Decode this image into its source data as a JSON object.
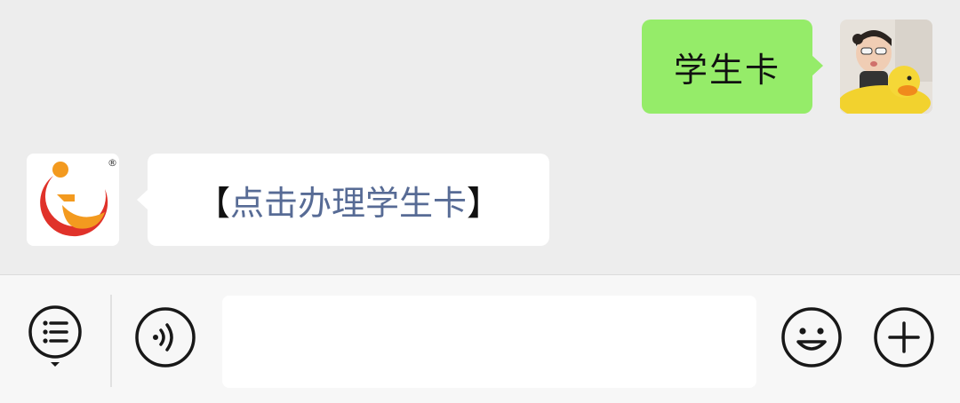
{
  "messages": {
    "outgoing": {
      "text": "学生卡",
      "avatar_icon": "user-photo-avatar",
      "bubble_color": "#95ec69"
    },
    "incoming": {
      "bracket_open": "【",
      "link_text": "点击办理学生卡",
      "bracket_close": "】",
      "avatar_icon": "brand-logo-avatar",
      "link_color": "#576b95",
      "logo_mark": "®"
    }
  },
  "input_bar": {
    "menu_icon": "menu-list-icon",
    "voice_icon": "voice-icon",
    "emoji_icon": "emoji-icon",
    "plus_icon": "plus-icon",
    "text_value": "",
    "placeholder": ""
  },
  "colors": {
    "chat_background": "#ededed",
    "input_bar_background": "#f7f7f7"
  }
}
